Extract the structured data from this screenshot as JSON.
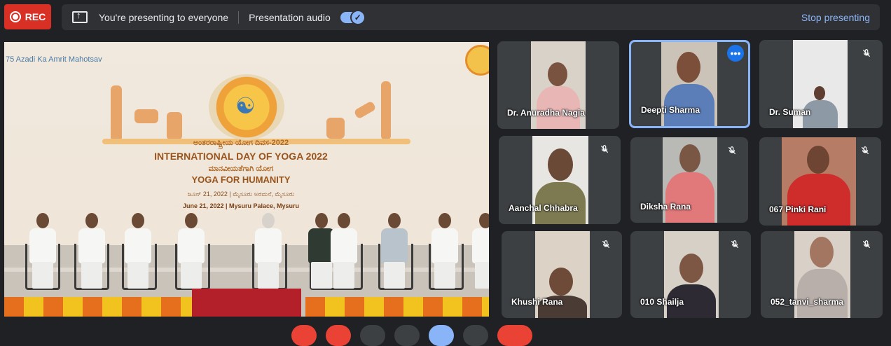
{
  "rec": {
    "label": "REC"
  },
  "present_bar": {
    "message": "You're presenting to everyone",
    "audio_label": "Presentation audio",
    "audio_enabled": true,
    "stop_label": "Stop presenting"
  },
  "stage": {
    "logo_left": "75 Azadi Ka Amrit Mahotsav",
    "kannada_title": "ಅಂತರರಾಷ್ಟ್ರೀಯ ಯೋಗ ದಿವಸ-2022",
    "title": "INTERNATIONAL DAY OF YOGA 2022",
    "kannada_subtitle": "ಮಾನವೀಯತೆಗಾಗಿ ಯೋಗ",
    "subtitle": "YOGA FOR HUMANITY",
    "kannada_date": "ಜೂನ್ 21, 2022 | ಮೈಸೂರು ಅರಮನೆ, ಮೈಸೂರು",
    "date_venue": "June 21, 2022 | Mysuru Palace, Mysuru"
  },
  "participants": [
    {
      "name": "Dr. Anuradha Nagia",
      "muted": false,
      "active": false
    },
    {
      "name": "Deepti Sharma",
      "muted": false,
      "active": true
    },
    {
      "name": "Dr. Suman",
      "muted": true,
      "active": false
    },
    {
      "name": "Aanchal Chhabra",
      "muted": true,
      "active": false
    },
    {
      "name": "Diksha Rana",
      "muted": true,
      "active": false
    },
    {
      "name": "067 Pinki Rani",
      "muted": true,
      "active": false
    },
    {
      "name": "Khushi Rana",
      "muted": true,
      "active": false
    },
    {
      "name": "010 Shailja",
      "muted": true,
      "active": false
    },
    {
      "name": "052_tanvi_sharma",
      "muted": true,
      "active": false
    }
  ],
  "colors": {
    "rec": "#d93025",
    "accent": "#8ab4f8",
    "active_border": "#8ab4f8",
    "background": "#202124"
  },
  "icons": {
    "more": "more-options-icon",
    "mic_off": "mic-off-icon",
    "present": "present-screen-icon"
  }
}
